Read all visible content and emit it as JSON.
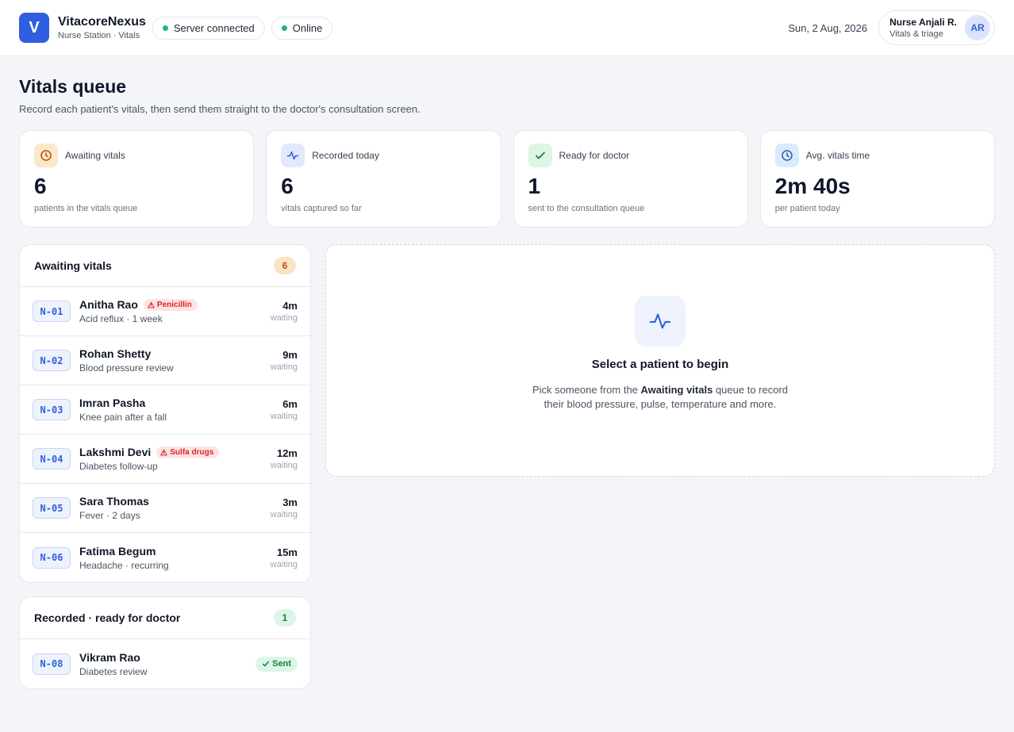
{
  "header": {
    "logo_letter": "V",
    "app_name": "VitacoreNexus",
    "app_sub": "Nurse Station · Vitals",
    "status_server": "Server connected",
    "status_online": "Online",
    "status_color": "#22b573",
    "date": "Sun, 2 Aug, 2026",
    "user_name": "Nurse Anjali R.",
    "user_role": "Vitals & triage",
    "user_initials": "AR"
  },
  "page": {
    "title": "Vitals queue",
    "subtitle": "Record each patient's vitals, then send them straight to the doctor's consultation screen."
  },
  "stats": [
    {
      "icon": "clock-icon",
      "label": "Awaiting vitals",
      "value": "6",
      "note": "patients in the vitals queue"
    },
    {
      "icon": "pulse-icon",
      "label": "Recorded today",
      "value": "6",
      "note": "vitals captured so far"
    },
    {
      "icon": "check-icon",
      "label": "Ready for doctor",
      "value": "1",
      "note": "sent to the consultation queue"
    },
    {
      "icon": "clock-icon",
      "label": "Avg. vitals time",
      "value": "2m 40s",
      "note": "per patient today"
    }
  ],
  "awaiting": {
    "title": "Awaiting vitals",
    "count": "6",
    "wait_label": "waiting",
    "patients": [
      {
        "token": "N-01",
        "name": "Anitha Rao",
        "reason": "Acid reflux · 1 week",
        "allergy": "Penicillin",
        "wait": "4m"
      },
      {
        "token": "N-02",
        "name": "Rohan Shetty",
        "reason": "Blood pressure review",
        "allergy": "",
        "wait": "9m"
      },
      {
        "token": "N-03",
        "name": "Imran Pasha",
        "reason": "Knee pain after a fall",
        "allergy": "",
        "wait": "6m"
      },
      {
        "token": "N-04",
        "name": "Lakshmi Devi",
        "reason": "Diabetes follow-up",
        "allergy": "Sulfa drugs",
        "wait": "12m"
      },
      {
        "token": "N-05",
        "name": "Sara Thomas",
        "reason": "Fever · 2 days",
        "allergy": "",
        "wait": "3m"
      },
      {
        "token": "N-06",
        "name": "Fatima Begum",
        "reason": "Headache · recurring",
        "allergy": "",
        "wait": "15m"
      }
    ]
  },
  "recorded": {
    "title": "Recorded · ready for doctor",
    "count": "1",
    "patients": [
      {
        "token": "N-08",
        "name": "Vikram Rao",
        "reason": "Diabetes review",
        "status": "Sent"
      }
    ]
  },
  "empty_state": {
    "icon": "pulse-icon",
    "title": "Select a patient to begin",
    "text_before": "Pick someone from the ",
    "text_bold": "Awaiting vitals",
    "text_after": " queue to record their blood pressure, pulse, temperature and more."
  }
}
